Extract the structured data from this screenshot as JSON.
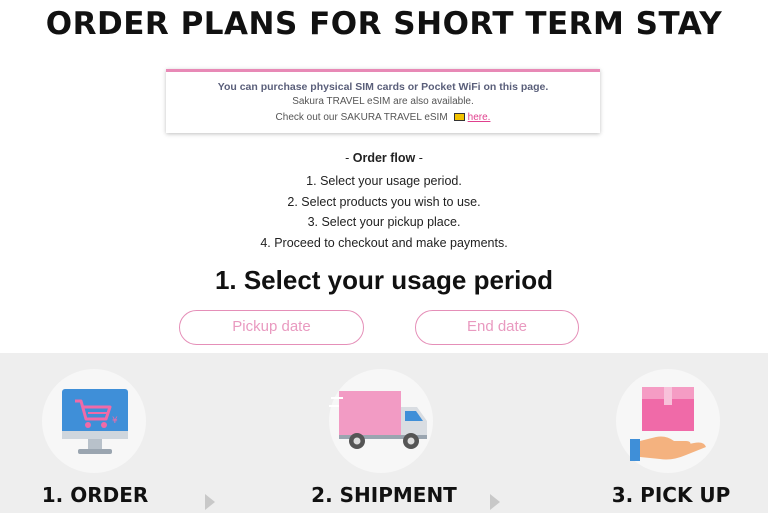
{
  "page": {
    "title": "ORDER PLANS FOR SHORT TERM STAY"
  },
  "notice": {
    "line1": "You can purchase physical SIM cards or Pocket WiFi on this page.",
    "line2": "Sakura TRAVEL eSIM are also available.",
    "line3_prefix": "Check out our SAKURA TRAVEL eSIM",
    "link_text": "here.",
    "accent_color": "#e889b6"
  },
  "order_flow": {
    "title_dash_left": "- ",
    "title": "Order flow",
    "title_dash_right": " -",
    "steps": [
      "1. Select your usage period.",
      "2. Select products you wish to use.",
      "3. Select your pickup place.",
      "4. Proceed to checkout and make payments."
    ]
  },
  "usage_period": {
    "heading": "1. Select your usage period",
    "pickup_placeholder": "Pickup date",
    "end_placeholder": "End date",
    "button_color": "#e58fb8"
  },
  "process_steps": [
    {
      "label": "1. ORDER",
      "icon": "shopping-cart-monitor-icon"
    },
    {
      "label": "2. SHIPMENT",
      "icon": "delivery-truck-icon"
    },
    {
      "label": "3. PICK UP",
      "icon": "hand-box-icon"
    }
  ]
}
